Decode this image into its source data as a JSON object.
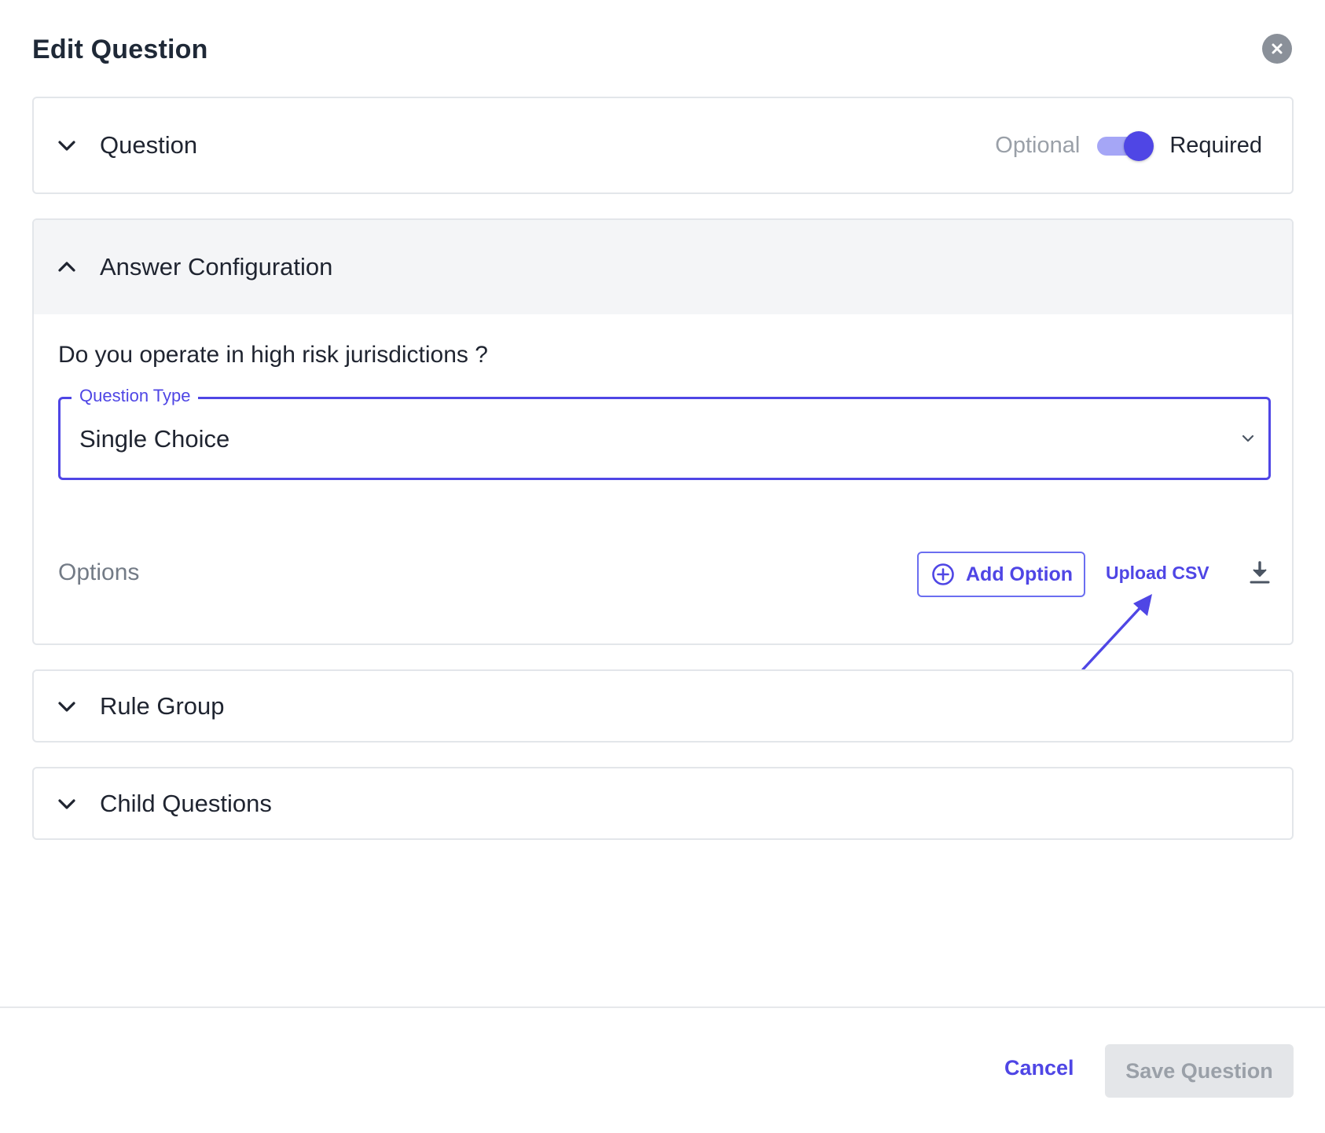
{
  "dialog": {
    "title": "Edit Question"
  },
  "sections": {
    "question": {
      "title": "Question",
      "expanded": false
    },
    "answer_configuration": {
      "title": "Answer Configuration",
      "expanded": true
    },
    "rule_group": {
      "title": "Rule Group",
      "expanded": false
    },
    "child_questions": {
      "title": "Child Questions",
      "expanded": false
    }
  },
  "required_toggle": {
    "optional_label": "Optional",
    "required_label": "Required",
    "state": "required"
  },
  "answer": {
    "question_text": "Do you operate in high risk jurisdictions ?",
    "question_type": {
      "label": "Question Type",
      "value": "Single Choice"
    },
    "options_label": "Options",
    "add_option_label": "Add Option",
    "upload_csv_label": "Upload CSV"
  },
  "footer": {
    "cancel_label": "Cancel",
    "save_label": "Save Question"
  },
  "icons": {
    "close": "close-icon",
    "chevron_down": "chevron-down-icon",
    "chevron_up": "chevron-up-icon",
    "add": "plus-circle-icon",
    "download": "download-icon",
    "annotation": "arrow-icon"
  },
  "colors": {
    "accent": "#4f46e5",
    "toggle_track": "#a5a6f6",
    "header_bg": "#f4f5f7",
    "border": "#e3e6ea",
    "disabled_bg": "#e4e6e9",
    "disabled_text": "#9aa0a8"
  }
}
